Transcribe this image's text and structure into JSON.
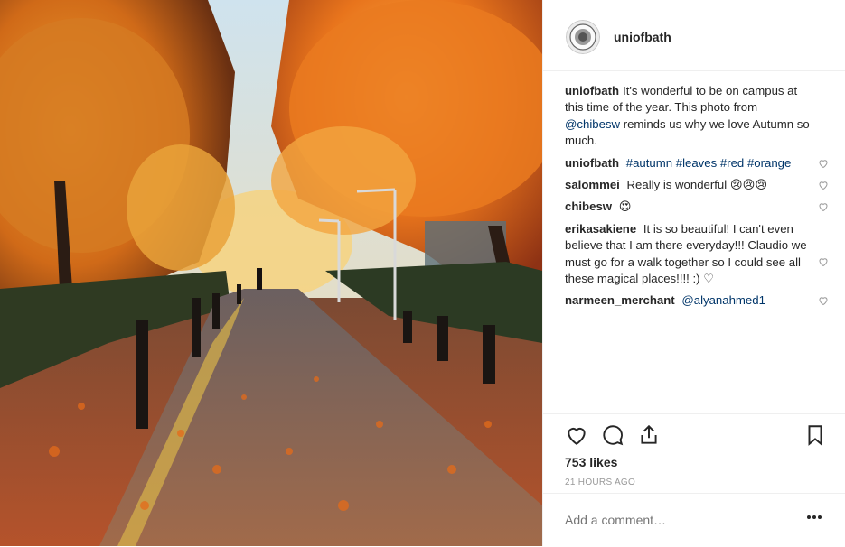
{
  "post": {
    "username": "uniofbath",
    "avatar_icon": "university-crest-icon"
  },
  "caption": {
    "user": "uniofbath",
    "text_before": "It's wonderful to be on campus at this time of the year. This photo from ",
    "mention": "@chibesw",
    "text_after": " reminds us why we love Autumn so much."
  },
  "comments": [
    {
      "user": "uniofbath",
      "text": "",
      "tags": [
        "#autumn",
        "#leaves",
        "#red",
        "#orange"
      ]
    },
    {
      "user": "salommei",
      "text": "Really is wonderful",
      "emoji": "😢😢😢"
    },
    {
      "user": "chibesw",
      "text": "",
      "emoji": "😍"
    },
    {
      "user": "erikasakiene",
      "text": "It is so beautiful! I can't even believe that I am there everyday!!! Claudio we must go for a walk together so I could see all these magical places!!!!",
      "suffix": ":)",
      "emoji": "♡"
    },
    {
      "user": "narmeen_merchant",
      "text": "",
      "mention": "@alyanahmed1"
    }
  ],
  "actions": {
    "likes": "753 likes",
    "time": "21 HOURS AGO",
    "icons": [
      "heart-icon",
      "comment-icon",
      "share-icon",
      "bookmark-icon"
    ]
  },
  "add_comment": {
    "placeholder": "Add a comment…"
  }
}
